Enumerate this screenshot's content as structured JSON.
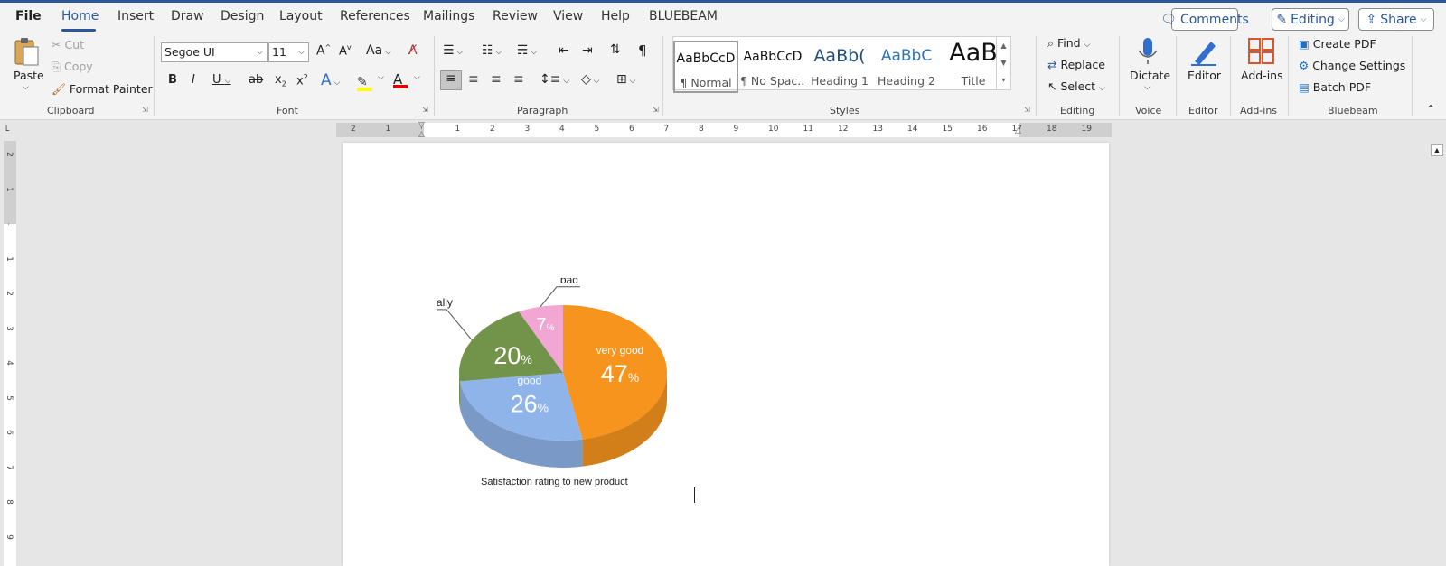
{
  "tabs": {
    "file": "File",
    "home": "Home",
    "insert": "Insert",
    "draw": "Draw",
    "design": "Design",
    "layout": "Layout",
    "references": "References",
    "mailings": "Mailings",
    "review": "Review",
    "view": "View",
    "help": "Help",
    "bluebeam": "BLUEBEAM"
  },
  "toolbar": {
    "comments": "Comments",
    "editing": "Editing",
    "share": "Share"
  },
  "clipboard": {
    "paste": "Paste",
    "cut": "Cut",
    "copy": "Copy",
    "format_painter": "Format Painter",
    "label": "Clipboard"
  },
  "font": {
    "name": "Segoe UI",
    "size": "11",
    "change_case": "Aa",
    "label": "Font"
  },
  "paragraph": {
    "label": "Paragraph"
  },
  "styles": {
    "label": "Styles",
    "items": [
      {
        "preview": "AaBbCcD",
        "name": "¶ Normal"
      },
      {
        "preview": "AaBbCcD",
        "name": "¶ No Spac..."
      },
      {
        "preview": "AaBb(",
        "name": "Heading 1"
      },
      {
        "preview": "AaBbC",
        "name": "Heading 2"
      },
      {
        "preview": "AaB",
        "name": "Title"
      }
    ]
  },
  "editing": {
    "find": "Find",
    "replace": "Replace",
    "select": "Select",
    "label": "Editing"
  },
  "voice": {
    "dictate": "Dictate",
    "label": "Voice"
  },
  "editor": {
    "button": "Editor",
    "label": "Editor"
  },
  "addins": {
    "button": "Add-ins",
    "label": "Add-ins"
  },
  "bluebeam": {
    "create": "Create PDF",
    "change": "Change Settings",
    "batch": "Batch PDF",
    "label": "Bluebeam"
  },
  "ruler": {
    "numbers": [
      "2",
      "1",
      "",
      "1",
      "2",
      "3",
      "4",
      "5",
      "6",
      "7",
      "8",
      "9",
      "10",
      "11",
      "12",
      "13",
      "14",
      "15",
      "16",
      "17",
      "18",
      "19"
    ]
  },
  "vruler": {
    "numbers": [
      "2",
      "1",
      "",
      "1",
      "2",
      "3",
      "4",
      "5",
      "6",
      "7",
      "8",
      "9"
    ]
  },
  "chart_data": {
    "type": "pie",
    "title": "Satisfaction rating to new product",
    "slices": [
      {
        "label": "very good",
        "value": 47,
        "display": "47",
        "color": "#f7941d"
      },
      {
        "label": "good",
        "value": 26,
        "display": "26",
        "color": "#8fb4ea"
      },
      {
        "label": "usually",
        "value": 20,
        "display": "20",
        "color": "#72944a"
      },
      {
        "label": "bad",
        "value": 7,
        "display": "7",
        "color": "#f2a6d4"
      }
    ],
    "unit": "%"
  }
}
